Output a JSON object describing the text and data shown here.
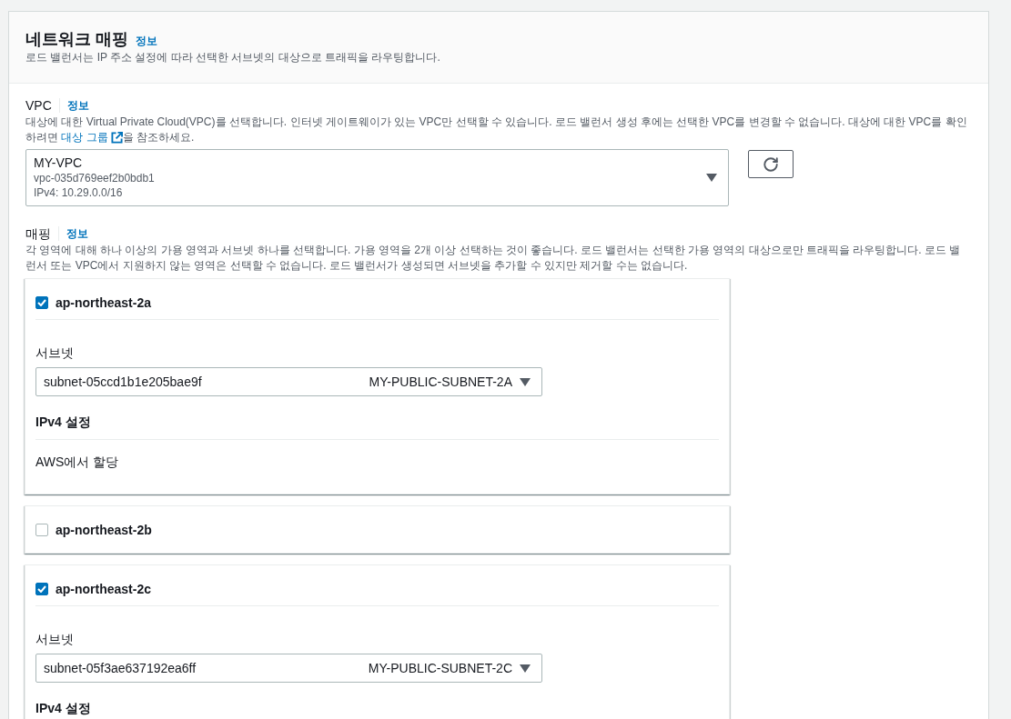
{
  "section": {
    "title": "네트워크 매핑",
    "info_link": "정보",
    "description": "로드 밸런서는 IP 주소 설정에 따라 선택한 서브넷의 대상으로 트래픽을 라우팅합니다."
  },
  "vpc": {
    "label": "VPC",
    "info_link": "정보",
    "description": "대상에 대한 Virtual Private Cloud(VPC)를 선택합니다. 인터넷 게이트웨이가 있는 VPC만 선택할 수 있습니다. 로드 밸런서 생성 후에는 선택한 VPC를 변경할 수 없습니다. 대상에 대한 VPC를 확인하려면 ",
    "link": "대상 그룹",
    "description_end": "을 참조하세요.",
    "select": {
      "name": "MY-VPC",
      "id": "vpc-035d769eef2b0bdb1",
      "cidr": "IPv4: 10.29.0.0/16"
    }
  },
  "mappings": {
    "label": "매핑",
    "info_link": "정보",
    "description": "각 영역에 대해 하나 이상의 가용 영역과 서브넷 하나를 선택합니다. 가용 영역을 2개 이상 선택하는 것이 좋습니다. 로드 밸런서는 선택한 가용 영역의 대상으로만 트래픽을 라우팅합니다. 로드 밸런서 또는 VPC에서 지원하지 않는 영역은 선택할 수 없습니다. 로드 밸런서가 생성되면 서브넷을 추가할 수 있지만 제거할 수는 없습니다.",
    "zones": [
      {
        "name": "ap-northeast-2a",
        "checked": true,
        "subnet_label": "서브넷",
        "subnet_id": "subnet-05ccd1b1e205bae9f",
        "subnet_name": "MY-PUBLIC-SUBNET-2A",
        "ipv4_label": "IPv4 설정",
        "ipv4_value": "AWS에서 할당"
      },
      {
        "name": "ap-northeast-2b",
        "checked": false
      },
      {
        "name": "ap-northeast-2c",
        "checked": true,
        "subnet_label": "서브넷",
        "subnet_id": "subnet-05f3ae637192ea6ff",
        "subnet_name": "MY-PUBLIC-SUBNET-2C",
        "ipv4_label": "IPv4 설정"
      }
    ]
  }
}
